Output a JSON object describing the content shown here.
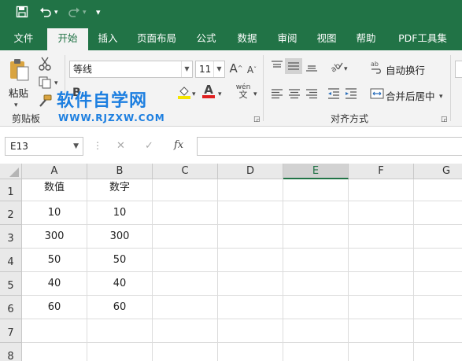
{
  "quick_access": {
    "save_icon": "save-icon",
    "undo_icon": "undo-icon",
    "redo_icon": "redo-icon",
    "customize_icon": "customize-qat-icon"
  },
  "tabs": [
    "文件",
    "开始",
    "插入",
    "页面布局",
    "公式",
    "数据",
    "审阅",
    "视图",
    "帮助",
    "PDF工具集"
  ],
  "active_tab": "开始",
  "ribbon": {
    "clipboard": {
      "paste_label": "粘贴",
      "group_label": "剪贴板"
    },
    "font": {
      "name": "等线",
      "size": "11",
      "phonetic_label": "wén",
      "phonetic_sub": "文"
    },
    "alignment": {
      "wrap_label": "自动换行",
      "merge_label": "合并后居中",
      "group_label": "对齐方式"
    },
    "font_color": "#e02020",
    "highlight_color": "#f5e500"
  },
  "watermark": {
    "title": "软件自学网",
    "url": "WWW.RJZXW.COM"
  },
  "formula_bar": {
    "name_box": "E13",
    "cancel_glyph": "✕",
    "enter_glyph": "✓",
    "fx_label": "fx",
    "value": ""
  },
  "sheet": {
    "columns": [
      "A",
      "B",
      "C",
      "D",
      "E",
      "F",
      "G"
    ],
    "selected_column": "E",
    "rows": [
      "1",
      "2",
      "3",
      "4",
      "5",
      "6",
      "7",
      "8"
    ],
    "cells": [
      [
        "数值",
        "数字"
      ],
      [
        "10",
        "10"
      ],
      [
        "300",
        "300"
      ],
      [
        "50",
        "50"
      ],
      [
        "40",
        "40"
      ],
      [
        "60",
        "60"
      ],
      [
        "",
        ""
      ],
      [
        "",
        ""
      ]
    ]
  },
  "accent_color": "#217346"
}
